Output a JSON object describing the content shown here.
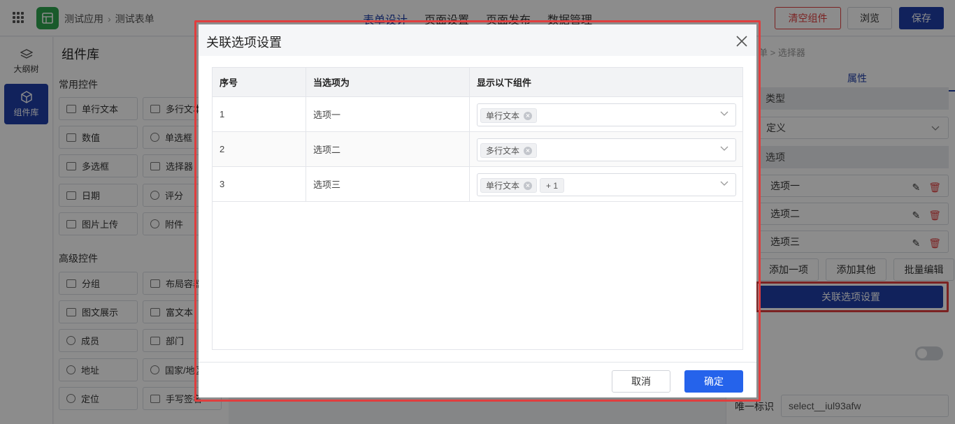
{
  "topbar": {
    "breadcrumb": [
      "测试应用",
      "测试表单"
    ],
    "tabs": [
      "表单设计",
      "页面设置",
      "页面发布",
      "数据管理"
    ],
    "buttons": {
      "clear": "清空组件",
      "preview": "浏览",
      "save": "保存"
    }
  },
  "rail": {
    "items": [
      {
        "label": "大纲树"
      },
      {
        "label": "组件库"
      }
    ]
  },
  "library": {
    "title": "组件库",
    "common_title": "常用控件",
    "common": [
      "单行文本",
      "多行文本",
      "数值",
      "单选框",
      "多选框",
      "选择器",
      "日期",
      "评分",
      "图片上传",
      "附件"
    ],
    "advanced_title": "高级控件",
    "advanced": [
      "分组",
      "布局容器",
      "图文展示",
      "富文本",
      "成员",
      "部门",
      "地址",
      "国家/地区",
      "定位",
      "手写签名"
    ]
  },
  "right_panel": {
    "breadcrumb": "单 > 选择器",
    "tab": "属性",
    "type_header": "类型",
    "type_value": "定义",
    "options_header": "选项",
    "options": [
      "选项一",
      "选项二",
      "选项三"
    ],
    "add_option": "添加一项",
    "add_other": "添加其他",
    "batch_edit": "批量编辑",
    "link_button": "关联选项设置",
    "unique_key_label": "唯一标识",
    "unique_key_value": "select__iul93afw"
  },
  "dialog": {
    "title": "关联选项设置",
    "columns": [
      "序号",
      "当选项为",
      "显示以下组件"
    ],
    "rows": [
      {
        "index": "1",
        "option": "选项一",
        "tags": [
          "单行文本"
        ]
      },
      {
        "index": "2",
        "option": "选项二",
        "tags": [
          "多行文本"
        ]
      },
      {
        "index": "3",
        "option": "选项三",
        "tags": [
          "单行文本"
        ],
        "more": "+ 1"
      }
    ],
    "cancel": "取消",
    "confirm": "确定"
  },
  "colors": {
    "primary": "#1f3fa8",
    "confirm": "#2563eb",
    "danger": "#e03e3e",
    "logo": "#2ea44f"
  }
}
